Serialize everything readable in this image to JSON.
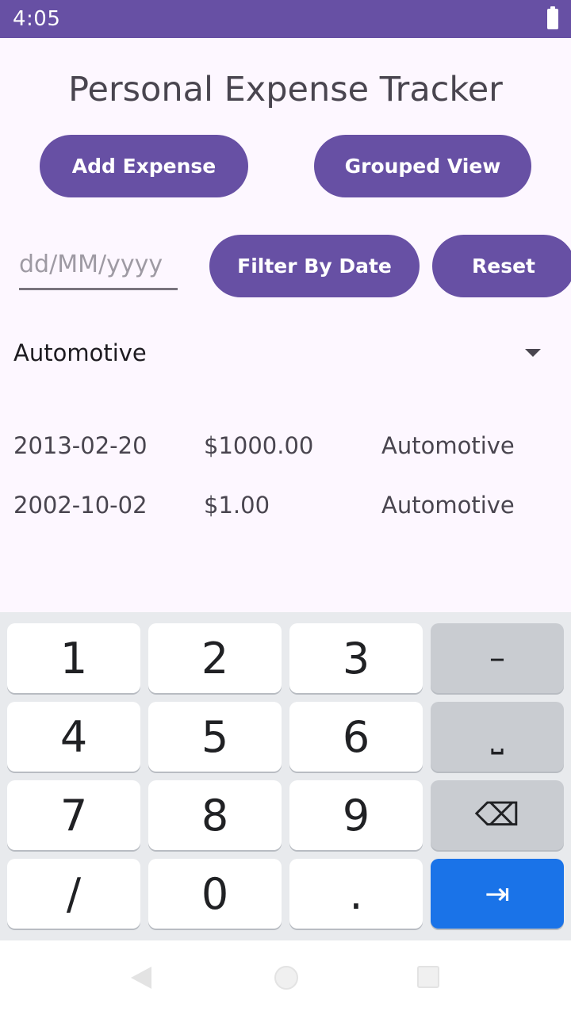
{
  "status_bar": {
    "time": "4:05"
  },
  "app": {
    "title": "Personal Expense Tracker"
  },
  "buttons": {
    "add_expense": "Add Expense",
    "grouped_view": "Grouped View",
    "filter_by_date": "Filter By Date",
    "reset": "Reset"
  },
  "date_filter": {
    "placeholder": "dd/MM/yyyy",
    "value": ""
  },
  "category_dropdown": {
    "selected": "Automotive"
  },
  "expenses": [
    {
      "date": "2013-02-20",
      "amount": "$1000.00",
      "category": "Automotive"
    },
    {
      "date": "2002-10-02",
      "amount": "$1.00",
      "category": "Automotive"
    }
  ],
  "keyboard": {
    "keys": [
      "1",
      "2",
      "3",
      "–",
      "4",
      "5",
      "6",
      "⎵",
      "7",
      "8",
      "9",
      "⌫",
      "/",
      "0",
      ".",
      "⇥"
    ]
  },
  "colors": {
    "primary": "#6750a4",
    "background": "#fdf7ff",
    "keyboard_go": "#1a73e8"
  }
}
